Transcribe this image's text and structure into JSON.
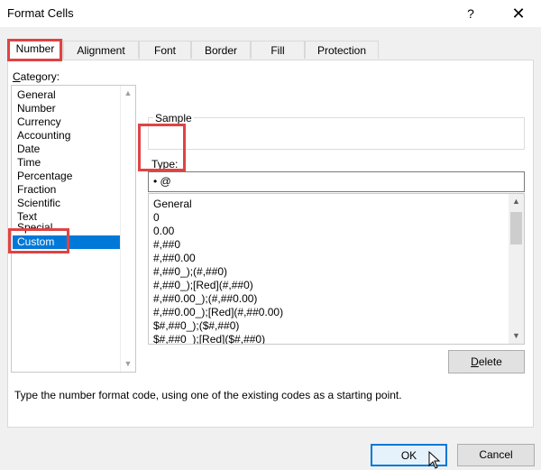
{
  "window": {
    "title": "Format Cells",
    "help_glyph": "?",
    "close_glyph": "✕"
  },
  "tabs": [
    {
      "label": "Number",
      "active": true
    },
    {
      "label": "Alignment",
      "active": false
    },
    {
      "label": "Font",
      "active": false
    },
    {
      "label": "Border",
      "active": false
    },
    {
      "label": "Fill",
      "active": false
    },
    {
      "label": "Protection",
      "active": false
    }
  ],
  "category": {
    "label": "Category:",
    "items": [
      "General",
      "Number",
      "Currency",
      "Accounting",
      "Date",
      "Time",
      "Percentage",
      "Fraction",
      "Scientific",
      "Text",
      "Special",
      "Custom"
    ],
    "selected": "Custom"
  },
  "sample": {
    "label": "Sample"
  },
  "type": {
    "label": "Type:",
    "value": "• @"
  },
  "format_codes": [
    "General",
    "0",
    "0.00",
    "#,##0",
    "#,##0.00",
    "#,##0_);(#,##0)",
    "#,##0_);[Red](#,##0)",
    "#,##0.00_);(#,##0.00)",
    "#,##0.00_);[Red](#,##0.00)",
    "$#,##0_);($#,##0)",
    "$#,##0_);[Red]($#,##0)"
  ],
  "buttons": {
    "delete": "Delete",
    "ok": "OK",
    "cancel": "Cancel"
  },
  "hint": "Type the number format code, using one of the existing codes as a starting point.",
  "colors": {
    "highlight": "#e04343",
    "selection": "#0078d7"
  }
}
